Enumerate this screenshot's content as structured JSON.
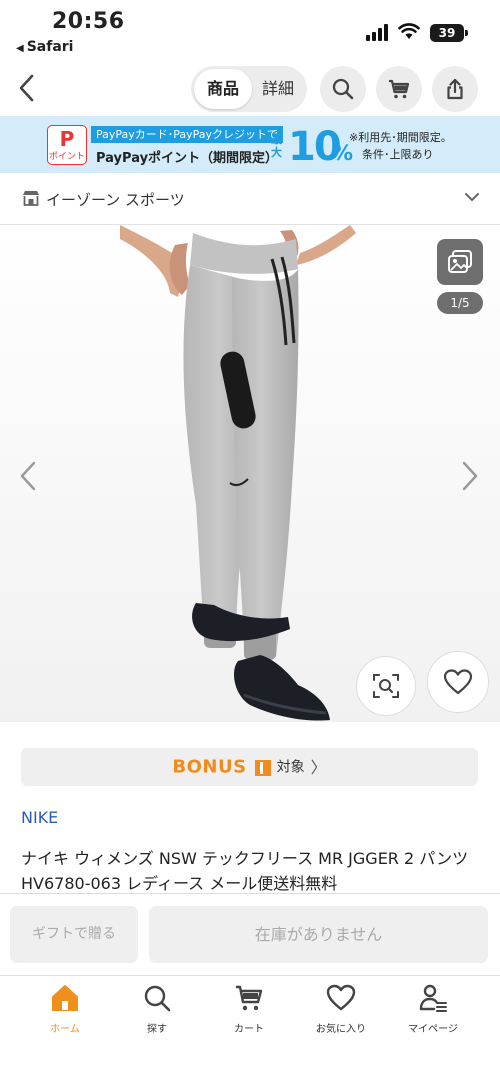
{
  "status_bar": {
    "time": "20:56",
    "back_app": "Safari",
    "battery": "39"
  },
  "header": {
    "segment_active": "商品",
    "segment_inactive": "詳細"
  },
  "promo": {
    "logo_top": "P",
    "logo_bottom": "ポイント",
    "line1": "PayPayカード･PayPayクレジットで",
    "line2": "PayPayポイント（期間限定）",
    "saidai": "最大",
    "percent_number": "10",
    "percent_sign": "%",
    "note1": "※利用先･期間限定。",
    "note2": "条件･上限あり",
    "accent_color": "#1e9de0"
  },
  "store": {
    "name": "イーゾーン スポーツ"
  },
  "gallery": {
    "counter": "1/5"
  },
  "bonus": {
    "label": "BONUS",
    "target": "対象",
    "arrow": "〉",
    "color": "#f28b1c"
  },
  "product": {
    "brand": "NIKE",
    "title": "ナイキ ウィメンズ NSW テックフリース MR JGGER 2 パンツ HV6780-063 レディース メール便送料無料"
  },
  "actions": {
    "gift": "ギフトで贈る",
    "stock": "在庫がありません"
  },
  "tabbar": {
    "items": [
      {
        "label": "ホーム",
        "icon": "home-icon"
      },
      {
        "label": "探す",
        "icon": "search-icon"
      },
      {
        "label": "カート",
        "icon": "cart-icon"
      },
      {
        "label": "お気に入り",
        "icon": "heart-icon"
      },
      {
        "label": "マイページ",
        "icon": "user-icon"
      }
    ],
    "active_color": "#f0901c"
  }
}
